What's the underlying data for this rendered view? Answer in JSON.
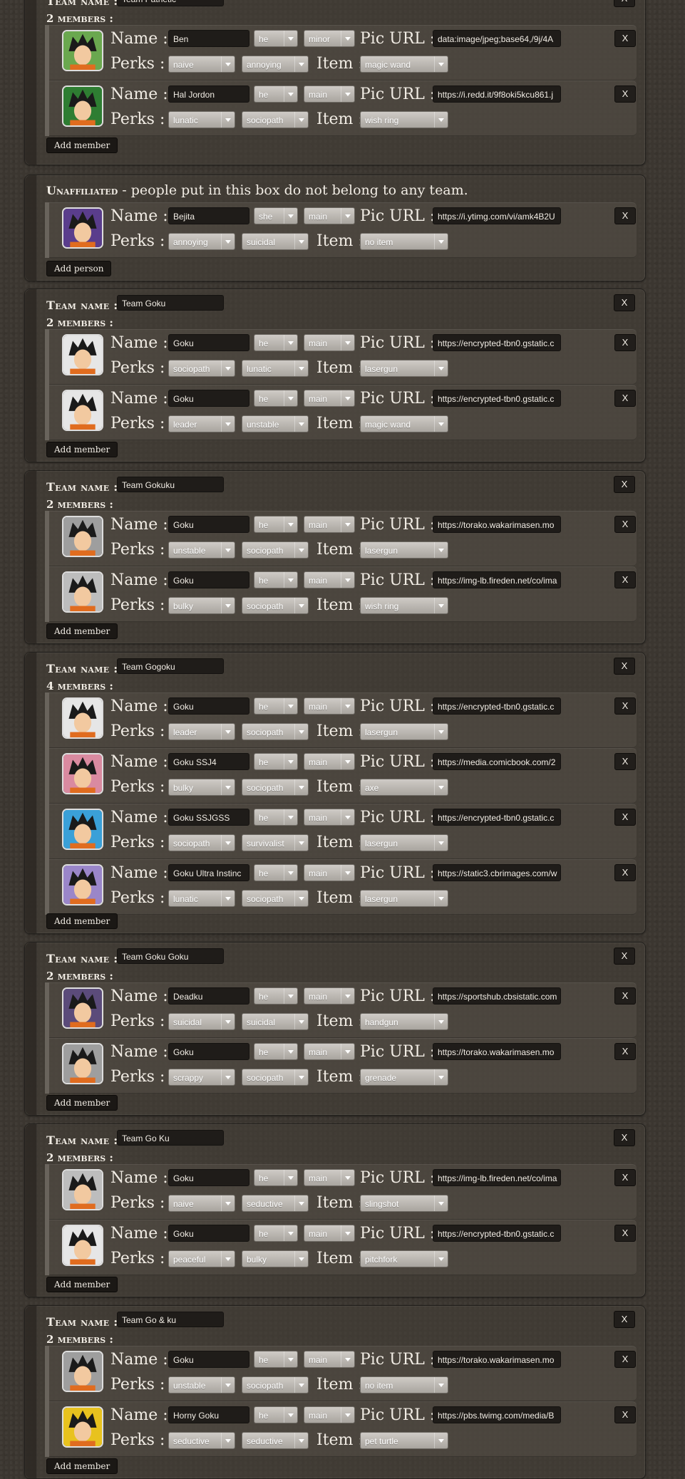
{
  "labels": {
    "team_name": "Team name :",
    "members_suffix": "members :",
    "name": "Name :",
    "perks": "Perks :",
    "item": "Item :",
    "pic_url": "Pic URL :",
    "remove": "X",
    "add_member": "Add member",
    "add_person": "Add person"
  },
  "unaffiliated": {
    "title": "Unaffiliated",
    "description": "- people put in this box do not belong to any team.",
    "members": [
      {
        "name": "Bejita",
        "pronoun": "she",
        "role": "main",
        "pic_url": "https://i.ytimg.com/vi/amk4B2U",
        "perks": [
          "annoying",
          "suicidal"
        ],
        "item": "no item",
        "avatar_color": "#5a3d8c"
      }
    ]
  },
  "teams": [
    {
      "name": "Team Pathetic",
      "count": "2",
      "members": [
        {
          "name": "Ben",
          "pronoun": "he",
          "role": "minor",
          "pic_url": "data:image/jpeg;base64,/9j/4A",
          "perks": [
            "naive",
            "annoying"
          ],
          "item": "magic wand",
          "avatar_color": "#6aa84f"
        },
        {
          "name": "Hal Jordon",
          "pronoun": "he",
          "role": "main",
          "pic_url": "https://i.redd.it/9f8oki5kcu861.j",
          "perks": [
            "lunatic",
            "sociopath"
          ],
          "item": "wish ring",
          "avatar_color": "#2e7d32"
        }
      ]
    },
    {
      "name": "Team Goku",
      "count": "2",
      "members": [
        {
          "name": "Goku",
          "pronoun": "he",
          "role": "main",
          "pic_url": "https://encrypted-tbn0.gstatic.c",
          "perks": [
            "sociopath",
            "lunatic"
          ],
          "item": "lasergun",
          "avatar_color": "#e6e6e6"
        },
        {
          "name": "Goku",
          "pronoun": "he",
          "role": "main",
          "pic_url": "https://encrypted-tbn0.gstatic.c",
          "perks": [
            "leader",
            "unstable"
          ],
          "item": "magic wand",
          "avatar_color": "#e6e6e6"
        }
      ]
    },
    {
      "name": "Team Gokuku",
      "count": "2",
      "members": [
        {
          "name": "Goku",
          "pronoun": "he",
          "role": "main",
          "pic_url": "https://torako.wakarimasen.mo",
          "perks": [
            "unstable",
            "sociopath"
          ],
          "item": "lasergun",
          "avatar_color": "#9e9e9e"
        },
        {
          "name": "Goku",
          "pronoun": "he",
          "role": "main",
          "pic_url": "https://img-lb.fireden.net/co/ima",
          "perks": [
            "bulky",
            "sociopath"
          ],
          "item": "wish ring",
          "avatar_color": "#bdbdbd"
        }
      ]
    },
    {
      "name": "Team Gogoku",
      "count": "4",
      "members": [
        {
          "name": "Goku",
          "pronoun": "he",
          "role": "main",
          "pic_url": "https://encrypted-tbn0.gstatic.c",
          "perks": [
            "leader",
            "sociopath"
          ],
          "item": "lasergun",
          "avatar_color": "#e6e6e6"
        },
        {
          "name": "Goku SSJ4",
          "pronoun": "he",
          "role": "main",
          "pic_url": "https://media.comicbook.com/2",
          "perks": [
            "bulky",
            "sociopath"
          ],
          "item": "axe",
          "avatar_color": "#d98aa0"
        },
        {
          "name": "Goku SSJGSS",
          "pronoun": "he",
          "role": "main",
          "pic_url": "https://encrypted-tbn0.gstatic.c",
          "perks": [
            "sociopath",
            "survivalist"
          ],
          "item": "lasergun",
          "avatar_color": "#3aa0d8"
        },
        {
          "name": "Goku Ultra Instinc",
          "pronoun": "he",
          "role": "main",
          "pic_url": "https://static3.cbrimages.com/w",
          "perks": [
            "lunatic",
            "sociopath"
          ],
          "item": "lasergun",
          "avatar_color": "#9a86c9"
        }
      ]
    },
    {
      "name": "Team Goku Goku",
      "count": "2",
      "members": [
        {
          "name": "Deadku",
          "pronoun": "he",
          "role": "main",
          "pic_url": "https://sportshub.cbsistatic.com",
          "perks": [
            "suicidal",
            "suicidal"
          ],
          "item": "handgun",
          "avatar_color": "#5b4b7a"
        },
        {
          "name": "Goku",
          "pronoun": "he",
          "role": "main",
          "pic_url": "https://torako.wakarimasen.mo",
          "perks": [
            "scrappy",
            "sociopath"
          ],
          "item": "grenade",
          "avatar_color": "#9e9e9e"
        }
      ]
    },
    {
      "name": "Team Go Ku",
      "count": "2",
      "members": [
        {
          "name": "Goku",
          "pronoun": "he",
          "role": "main",
          "pic_url": "https://img-lb.fireden.net/co/ima",
          "perks": [
            "naive",
            "seductive"
          ],
          "item": "slingshot",
          "avatar_color": "#bdbdbd"
        },
        {
          "name": "Goku",
          "pronoun": "he",
          "role": "main",
          "pic_url": "https://encrypted-tbn0.gstatic.c",
          "perks": [
            "peaceful",
            "bulky"
          ],
          "item": "pitchfork",
          "avatar_color": "#e6e6e6"
        }
      ]
    },
    {
      "name": "Team Go & ku",
      "count": "2",
      "members": [
        {
          "name": "Goku",
          "pronoun": "he",
          "role": "main",
          "pic_url": "https://torako.wakarimasen.mo",
          "perks": [
            "unstable",
            "sociopath"
          ],
          "item": "no item",
          "avatar_color": "#9e9e9e"
        },
        {
          "name": "Horny Goku",
          "pronoun": "he",
          "role": "main",
          "pic_url": "https://pbs.twimg.com/media/B",
          "perks": [
            "seductive",
            "seductive"
          ],
          "item": "pet turtle",
          "avatar_color": "#e8c21e"
        }
      ]
    }
  ]
}
